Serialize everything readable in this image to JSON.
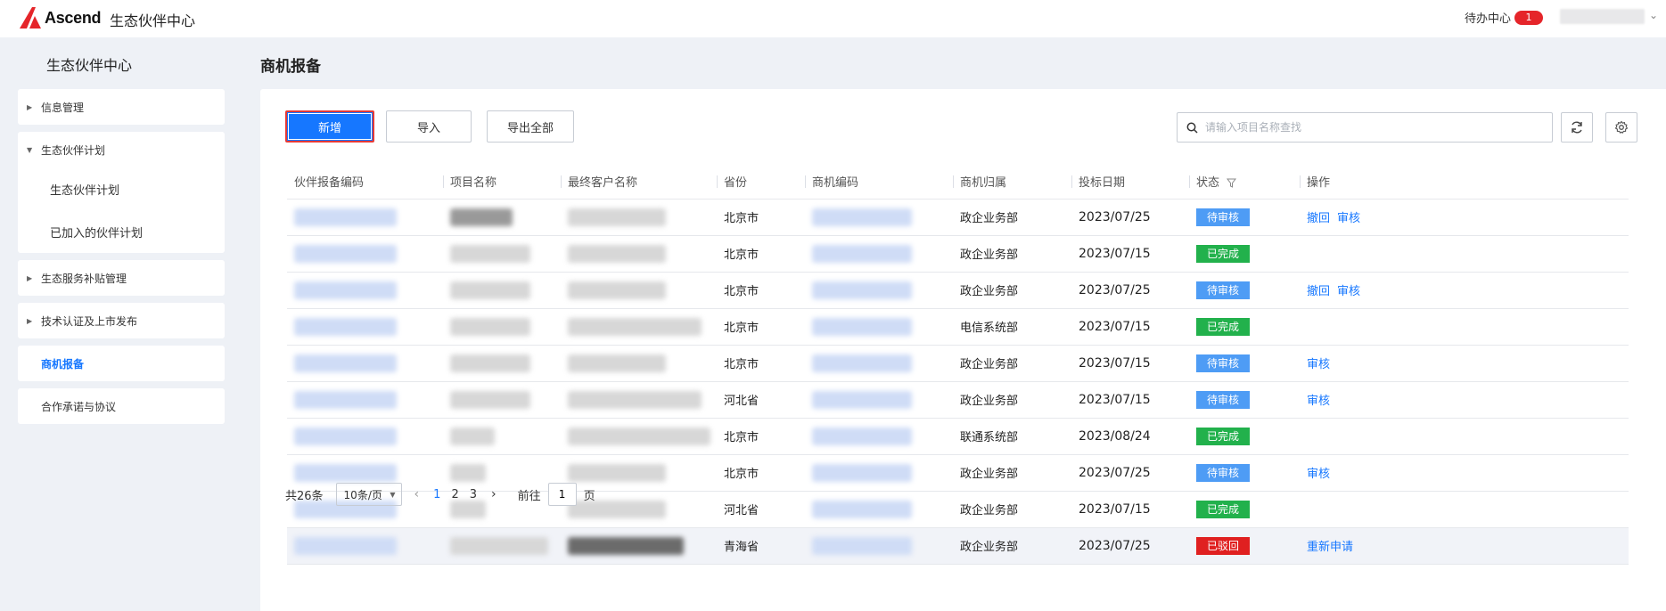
{
  "header": {
    "brand": "Ascend",
    "app_title": "生态伙伴中心",
    "todo_label": "待办中心",
    "todo_count": "1"
  },
  "sidebar": {
    "title": "生态伙伴中心",
    "items": [
      {
        "label": "信息管理"
      },
      {
        "label": "生态伙伴计划",
        "children": [
          "生态伙伴计划",
          "已加入的伙伴计划"
        ]
      },
      {
        "label": "生态服务补贴管理"
      },
      {
        "label": "技术认证及上市发布"
      },
      {
        "label": "商机报备"
      },
      {
        "label": "合作承诺与协议"
      }
    ]
  },
  "main": {
    "title": "商机报备",
    "toolbar": {
      "add_label": "新增",
      "import_label": "导入",
      "export_label": "导出全部",
      "search_placeholder": "请输入项目名称查找"
    },
    "table": {
      "columns": [
        "伙伴报备编码",
        "项目名称",
        "最终客户名称",
        "省份",
        "商机编码",
        "商机归属",
        "投标日期",
        "状态",
        "操作"
      ],
      "rows": [
        {
          "province": "北京市",
          "owner": "政企业务部",
          "date": "2023/07/25",
          "status": "待审核",
          "actions": [
            "撤回",
            "审核"
          ]
        },
        {
          "province": "北京市",
          "owner": "政企业务部",
          "date": "2023/07/15",
          "status": "已完成",
          "actions": []
        },
        {
          "province": "北京市",
          "owner": "政企业务部",
          "date": "2023/07/25",
          "status": "待审核",
          "actions": [
            "撤回",
            "审核"
          ]
        },
        {
          "province": "北京市",
          "owner": "电信系统部",
          "date": "2023/07/15",
          "status": "已完成",
          "actions": []
        },
        {
          "province": "北京市",
          "owner": "政企业务部",
          "date": "2023/07/15",
          "status": "待审核",
          "actions": [
            "审核"
          ]
        },
        {
          "province": "河北省",
          "owner": "政企业务部",
          "date": "2023/07/15",
          "status": "待审核",
          "actions": [
            "审核"
          ]
        },
        {
          "province": "北京市",
          "owner": "联通系统部",
          "date": "2023/08/24",
          "status": "已完成",
          "actions": []
        },
        {
          "province": "北京市",
          "owner": "政企业务部",
          "date": "2023/07/25",
          "status": "待审核",
          "actions": [
            "审核"
          ]
        },
        {
          "province": "河北省",
          "owner": "政企业务部",
          "date": "2023/07/15",
          "status": "已完成",
          "actions": []
        },
        {
          "province": "青海省",
          "owner": "政企业务部",
          "date": "2023/07/25",
          "status": "已驳回",
          "actions": [
            "重新申请"
          ]
        }
      ]
    },
    "status_colors": {
      "待审核": "#4e9cf5",
      "已完成": "#22b14c",
      "已驳回": "#e02020"
    },
    "pagination": {
      "total": "共26条",
      "page_size": "10条/页",
      "pages": [
        "1",
        "2",
        "3"
      ],
      "current": "1",
      "goto_label": "前往",
      "goto_value": "1",
      "page_suffix": "页"
    }
  }
}
